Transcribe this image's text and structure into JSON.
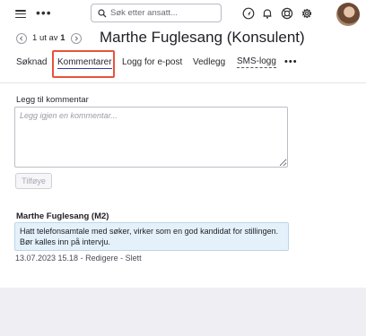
{
  "search": {
    "placeholder": "Søk etter ansatt..."
  },
  "icons": {
    "menu": "hamburger-icon",
    "more": "more-dots-icon",
    "search": "search-icon",
    "navigate": "navigation-arrow-icon",
    "notifications": "bell-icon",
    "help": "lifebuoy-icon",
    "settings": "gear-icon"
  },
  "header": {
    "pager_current": "1",
    "pager_of": "ut av",
    "pager_total": "1",
    "title": "Marthe Fuglesang (Konsulent)"
  },
  "tabs": [
    {
      "label": "Søknad"
    },
    {
      "label": "Kommentarer",
      "active": true
    },
    {
      "label": "Logg for e-post"
    },
    {
      "label": "Vedlegg"
    },
    {
      "label": "SMS-logg"
    }
  ],
  "tabs_more": "•••",
  "comment_form": {
    "label": "Legg til kommentar",
    "placeholder": "Legg igjen en kommentar...",
    "value": "",
    "button_label": "Tilføye"
  },
  "comments": [
    {
      "author": "Marthe Fuglesang (M2)",
      "text": "Hatt telefonsamtale med søker, virker som en god kandidat for stillingen. Bør kalles inn på intervju.",
      "timestamp": "13.07.2023 15.18",
      "separator": "-",
      "edit_label": "Redigere",
      "delete_label": "Slett"
    }
  ],
  "colors": {
    "highlight": "#e8543a",
    "comment_bg": "#e4f1fb",
    "page_bg": "#eeeef3",
    "active_tab_underline": "#3a3a9e"
  }
}
